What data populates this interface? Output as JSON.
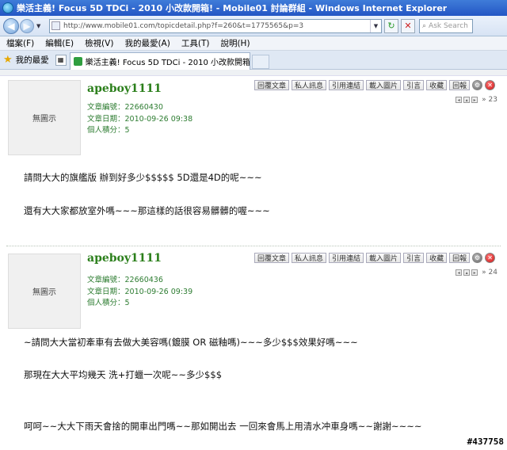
{
  "window": {
    "title": "樂活主義! Focus 5D TDCi - 2010 小改款開箱! - Mobile01 討論群組 - Windows Internet Explorer"
  },
  "address": {
    "url": "http://www.mobile01.com/topicdetail.php?f=260&t=1775565&p=3",
    "search_placeholder": "Ask Search"
  },
  "menu": {
    "items": [
      {
        "label": "檔案(F)"
      },
      {
        "label": "編輯(E)"
      },
      {
        "label": "檢視(V)"
      },
      {
        "label": "我的最愛(A)"
      },
      {
        "label": "工具(T)"
      },
      {
        "label": "說明(H)"
      }
    ]
  },
  "tabs": {
    "favorites_label": "我的最愛",
    "active_tab": "樂活主義! Focus 5D TDCi - 2010 小改款開箱! - Mo..."
  },
  "post_actions": [
    "回覆文章",
    "私人訊息",
    "引用連結",
    "載入圖片",
    "引言",
    "收藏",
    "回報"
  ],
  "posts": [
    {
      "avatar": "無圖示",
      "username": "apeboy1111",
      "id_label": "文章編號：",
      "id_value": "22660430",
      "date_label": "文章日期：",
      "date_value": "2010-09-26 09:38",
      "points_label": "個人積分：",
      "points_value": "5",
      "floor": "» 23",
      "lines": [
        "請問大大的旗艦版 辦到好多少$$$$$ 5D還是4D的呢~~~",
        "還有大大家都放室外嗎~~~那這樣的話很容易髒髒的喔~~~"
      ]
    },
    {
      "avatar": "無圖示",
      "username": "apeboy1111",
      "id_label": "文章編號：",
      "id_value": "22660436",
      "date_label": "文章日期：",
      "date_value": "2010-09-26 09:39",
      "points_label": "個人積分：",
      "points_value": "5",
      "floor": "» 24",
      "lines": [
        "~請問大大當初牽車有去做大美容嗎(鍍膜 OR 磁釉嗎)~~~多少$$$效果好嗎~~~",
        "那現在大大平均幾天 洗+打蠟一次呢~~多少$$$",
        "呵呵~~大大下雨天會捨的開車出門嗎~~那如開出去 一回來會馬上用清水冲車身嗎~~謝謝~~~~"
      ]
    }
  ],
  "watermark": "#437758",
  "colors": {
    "titlebar": "#2456c4",
    "username": "#2b7f1b",
    "meta": "#2e7d32"
  }
}
